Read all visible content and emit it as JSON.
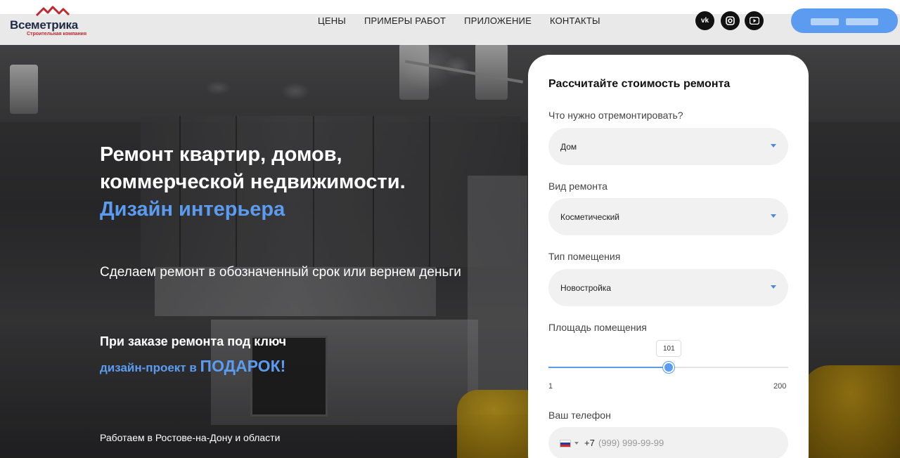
{
  "header": {
    "logo": {
      "name": "Всеметрика",
      "tagline": "Строительная компания"
    },
    "nav": [
      "ЦЕНЫ",
      "ПРИМЕРЫ РАБОТ",
      "ПРИЛОЖЕНИЕ",
      "КОНТАКТЫ"
    ],
    "social": [
      "vk-icon",
      "instagram-icon",
      "youtube-icon"
    ],
    "accent_color": "#5b9cf0"
  },
  "hero": {
    "title": "Ремонт квартир, домов, коммерческой недвижимости.",
    "title_accent": "Дизайн интерьера",
    "subtitle": "Сделаем ремонт в обозначенный срок или вернем деньги",
    "promo_line1": "При заказе ремонта под ключ",
    "promo_line2_small": "дизайн-проект в ",
    "promo_line2_big": "ПОДАРОК!",
    "region": "Работаем в Ростове-на-Дону и области"
  },
  "calculator": {
    "title": "Рассчитайте стоимость ремонта",
    "fields": [
      {
        "label": "Что нужно отремонтировать?",
        "value": "Дом"
      },
      {
        "label": "Вид ремонта",
        "value": "Косметический"
      },
      {
        "label": "Тип помещения",
        "value": "Новостройка"
      }
    ],
    "area": {
      "label": "Площадь помещения",
      "value": 101,
      "min": 1,
      "max": 200
    },
    "phone": {
      "label": "Ваш телефон",
      "code": "+7",
      "placeholder": "(999) 999-99-99"
    }
  }
}
